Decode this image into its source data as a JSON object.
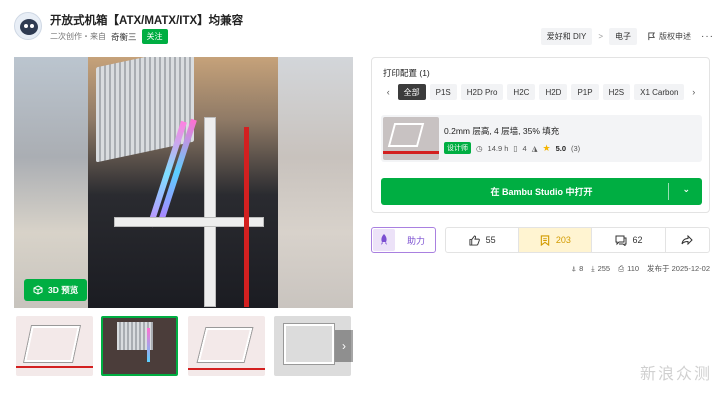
{
  "header": {
    "title": "开放式机箱【ATX/MATX/ITX】均兼容",
    "source_text": "二次创作・来自",
    "author": "奇衡三",
    "follow_label": "关注",
    "breadcrumbs": [
      "爱好和 DIY",
      "电子"
    ],
    "breadcrumb_sep": ">",
    "report_label": "版权申述",
    "more_label": "···"
  },
  "gallery": {
    "preview_3d_label": "3D 预览",
    "thumb_count": 4,
    "active_thumb": 1,
    "next_label": "›"
  },
  "print_config": {
    "title": "打印配置 (1)",
    "prev_label": "‹",
    "next_label": "›",
    "tabs": [
      "全部",
      "P1S",
      "H2D Pro",
      "H2C",
      "H2D",
      "P1P",
      "H2S",
      "X1 Carbon"
    ],
    "active_tab": 0,
    "profile": {
      "name": "0.2mm 层高, 4 层墙, 35% 填充",
      "badge": "设计师",
      "time": "14.9 h",
      "plates": "4",
      "rating": "5.0",
      "rating_count": "(3)"
    },
    "open_button_label": "在 Bambu Studio 中打开"
  },
  "actions": {
    "boost_label": "助力",
    "likes": "55",
    "favorites": "203",
    "comments": "62"
  },
  "footer_stats": {
    "boosts": "8",
    "downloads": "255",
    "prints": "110",
    "published": "发布于 2025-12-02"
  },
  "watermark": "新浪众测",
  "colors": {
    "accent_green": "#00ae42",
    "boost_purple": "#7b4fd1",
    "favorite_amber": "#d29b00"
  }
}
